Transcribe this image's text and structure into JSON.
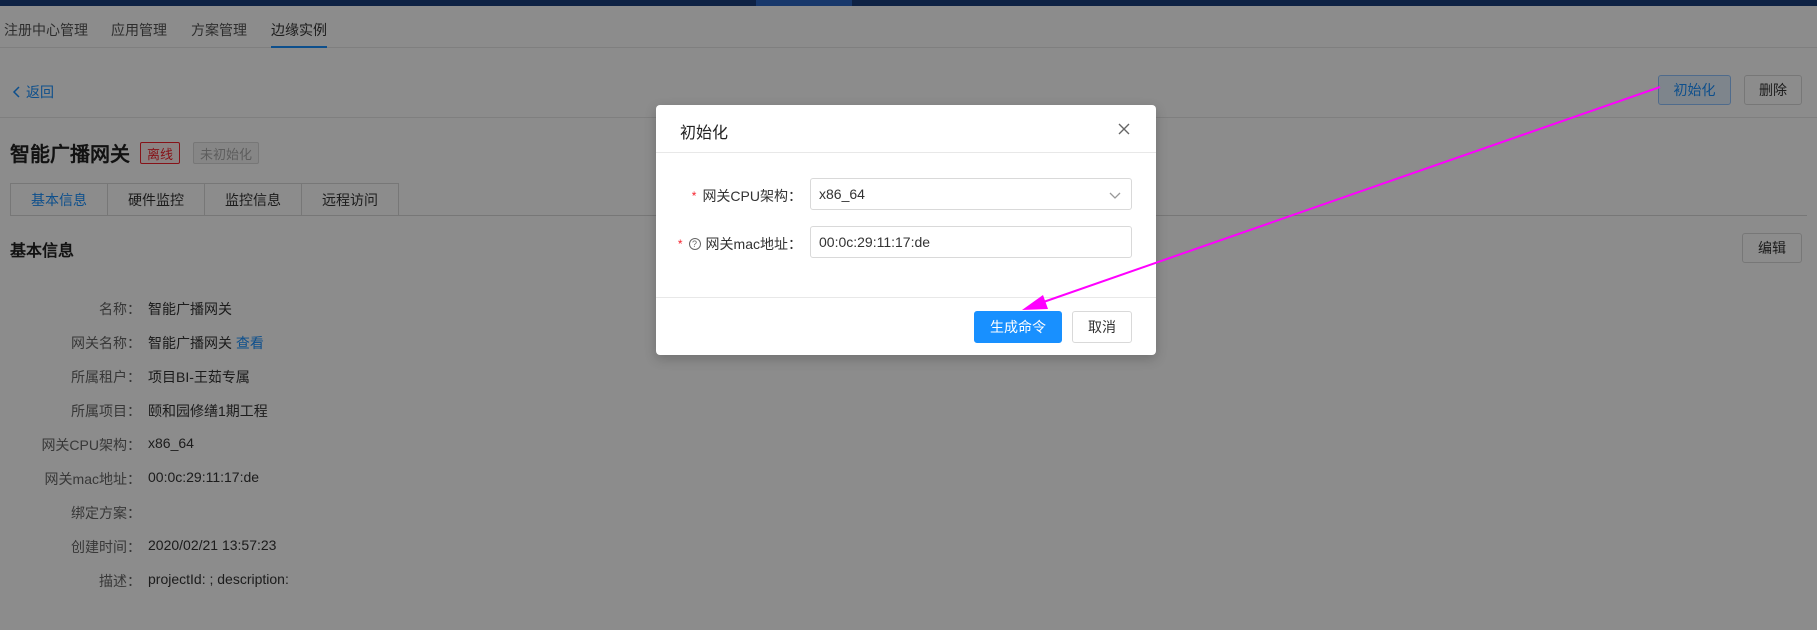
{
  "nav": {
    "tabs": [
      "注册中心管理",
      "应用管理",
      "方案管理",
      "边缘实例"
    ],
    "active": "边缘实例"
  },
  "subbar": {
    "back_label": "返回",
    "init_label": "初始化",
    "delete_label": "删除"
  },
  "header": {
    "title": "智能广播网关",
    "status_offline": "离线",
    "status_uninit": "未初始化"
  },
  "detail_tabs": [
    "基本信息",
    "硬件监控",
    "监控信息",
    "远程访问"
  ],
  "basic_info": {
    "section_title": "基本信息",
    "edit_label": "编辑",
    "rows": [
      {
        "label": "名称：",
        "value": "智能广播网关"
      },
      {
        "label": "网关名称：",
        "value": "智能广播网关",
        "link": "查看"
      },
      {
        "label": "所属租户：",
        "value": "项目BI-王茹专属"
      },
      {
        "label": "所属项目：",
        "value": "颐和园修缮1期工程"
      },
      {
        "label": "网关CPU架构：",
        "value": "x86_64"
      },
      {
        "label": "网关mac地址：",
        "value": "00:0c:29:11:17:de"
      },
      {
        "label": "绑定方案：",
        "value": ""
      },
      {
        "label": "创建时间：",
        "value": "2020/02/21 13:57:23"
      },
      {
        "label": "描述：",
        "value": "projectId: ; description:"
      }
    ]
  },
  "modal": {
    "title": "初始化",
    "cpu_label": "网关CPU架构：",
    "cpu_value": "x86_64",
    "mac_label": "网关mac地址：",
    "mac_value": "00:0c:29:11:17:de",
    "ok_label": "生成命令",
    "cancel_label": "取消"
  },
  "colors": {
    "primary": "#1890ff",
    "danger": "#f5222d",
    "annotation_arrow": "#ff00ff"
  }
}
